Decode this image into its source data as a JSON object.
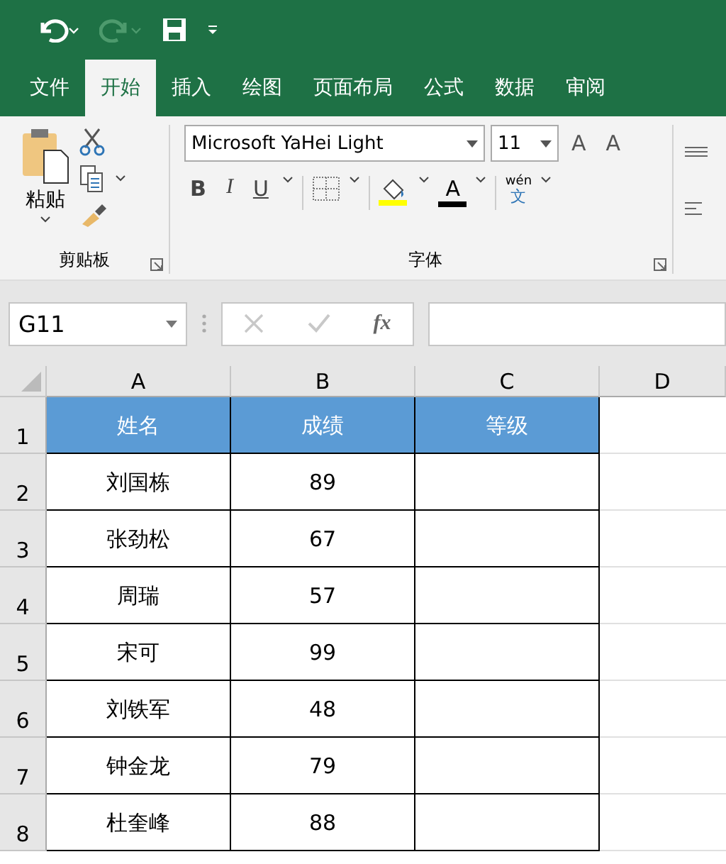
{
  "quick_access": [
    {
      "kind": "undo",
      "disabled": false
    },
    {
      "kind": "redo",
      "disabled": true
    },
    {
      "kind": "save",
      "disabled": false
    },
    {
      "kind": "customize",
      "disabled": false
    }
  ],
  "tabs": [
    {
      "label": "文件",
      "selected": false
    },
    {
      "label": "开始",
      "selected": true
    },
    {
      "label": "插入",
      "selected": false
    },
    {
      "label": "绘图",
      "selected": false
    },
    {
      "label": "页面布局",
      "selected": false
    },
    {
      "label": "公式",
      "selected": false
    },
    {
      "label": "数据",
      "selected": false
    },
    {
      "label": "审阅",
      "selected": false
    }
  ],
  "clipboard": {
    "paste_label": "粘贴",
    "group_label": "剪贴板"
  },
  "font": {
    "name": "Microsoft YaHei Light",
    "size": "11",
    "grow": "A",
    "shrink": "A",
    "styles": [
      {
        "kind": "bold",
        "label": "B"
      },
      {
        "kind": "italic",
        "label": "I"
      },
      {
        "kind": "underline",
        "label": "U"
      }
    ],
    "color_buttons": [
      {
        "kind": "fill",
        "color": "#ffff00"
      },
      {
        "kind": "font",
        "color": "#000000"
      }
    ],
    "font_color_label": "A",
    "phonetic_top": "wén",
    "phonetic_bottom": "文",
    "group_label": "字体"
  },
  "formula_bar": {
    "name_box": "G11",
    "fx": "fx"
  },
  "columns": [
    "A",
    "B",
    "C",
    "D"
  ],
  "rows": [
    {
      "number": "1",
      "kind": "header",
      "cells": [
        "姓名",
        "成绩",
        "等级"
      ]
    },
    {
      "number": "2",
      "kind": "data",
      "cells": [
        "刘国栋",
        "89"
      ]
    },
    {
      "number": "3",
      "kind": "data",
      "cells": [
        "张劲松",
        "67"
      ]
    },
    {
      "number": "4",
      "kind": "data",
      "cells": [
        "周瑞",
        "57"
      ]
    },
    {
      "number": "5",
      "kind": "data",
      "cells": [
        "宋可",
        "99"
      ]
    },
    {
      "number": "6",
      "kind": "data",
      "cells": [
        "刘铁军",
        "48"
      ]
    },
    {
      "number": "7",
      "kind": "data",
      "cells": [
        "钟金龙",
        "79"
      ]
    },
    {
      "number": "8",
      "kind": "data",
      "cells": [
        "杜奎峰",
        "88"
      ]
    }
  ]
}
